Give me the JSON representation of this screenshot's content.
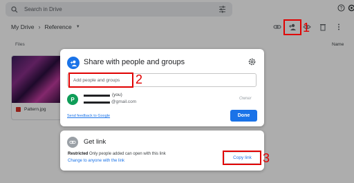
{
  "search": {
    "placeholder": "Search in Drive"
  },
  "breadcrumb": {
    "root": "My Drive",
    "current": "Reference"
  },
  "files": {
    "section_label": "Files",
    "sort_label": "Name",
    "items": [
      {
        "name": "Pattern.jpg"
      }
    ]
  },
  "share_dialog": {
    "title": "Share with people and groups",
    "input_placeholder": "Add people and groups",
    "person": {
      "avatar_letter": "P",
      "you_label": "(you)",
      "email_suffix": "@gmail.com",
      "role": "Owner"
    },
    "feedback_link": "Send feedback to Google",
    "done_label": "Done"
  },
  "get_link": {
    "title": "Get link",
    "restricted_label": "Restricted",
    "restricted_desc": "Only people added can open with this link",
    "change_link": "Change to anyone with the link",
    "copy_label": "Copy link"
  },
  "annotations": {
    "step1": "1",
    "step2": "2",
    "step3": "3",
    "color": "#e00000"
  },
  "colors": {
    "accent": "#1a73e8",
    "avatar": "#0f9d58",
    "scrim": "rgba(0,0,0,0.32)"
  },
  "icons": [
    "search-icon",
    "tune-icon",
    "help-icon",
    "settings-icon",
    "link-icon",
    "add-person-icon",
    "preview-icon",
    "trash-icon",
    "more-vert-icon",
    "image-icon",
    "gear-icon",
    "link-circle-icon"
  ]
}
